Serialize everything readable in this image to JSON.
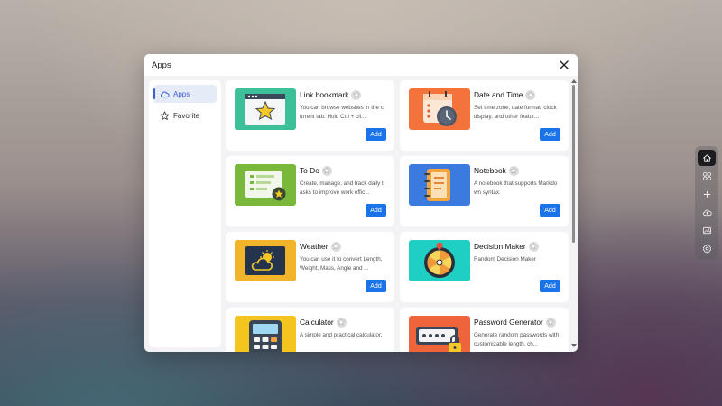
{
  "modal": {
    "title": "Apps"
  },
  "sidebar": {
    "items": [
      {
        "label": "Apps",
        "icon": "cloud-icon",
        "active": true
      },
      {
        "label": "Favorite",
        "icon": "star-outline-icon",
        "active": false
      }
    ]
  },
  "apps": [
    {
      "name": "Link bookmark",
      "desc": "You can browse websites in the current tab. Hold Ctrl + cli...",
      "add_label": "Add",
      "thumb_color": "#3dbf9a",
      "icon": "bookmark-star-icon"
    },
    {
      "name": "Date and Time",
      "desc": "Set time zone, date format, clock display, and other featur...",
      "add_label": "Add",
      "thumb_color": "#f4733a",
      "icon": "calendar-clock-icon"
    },
    {
      "name": "To Do",
      "desc": "Create, manage, and track daily tasks to improve work effic...",
      "add_label": "Add",
      "thumb_color": "#7ab83c",
      "icon": "todo-list-icon"
    },
    {
      "name": "Notebook",
      "desc": "A notebook that supports Markdown syntax.",
      "add_label": "Add",
      "thumb_color": "#3b7be0",
      "icon": "notebook-icon"
    },
    {
      "name": "Weather",
      "desc": "You can use it to convert Length, Weight, Mass, Angle and ...",
      "add_label": "Add",
      "thumb_color": "#f2b42a",
      "icon": "weather-icon"
    },
    {
      "name": "Decision Maker",
      "desc": "Random Decision Maker",
      "add_label": "Add",
      "thumb_color": "#1fcfc4",
      "icon": "decision-wheel-icon"
    },
    {
      "name": "Calculator",
      "desc": "A simple and practical calculator.",
      "add_label": "",
      "thumb_color": "#f5c51f",
      "icon": "calculator-icon"
    },
    {
      "name": "Password Generator",
      "desc": "Generate random passwords with customizable length, ch...",
      "add_label": "",
      "thumb_color": "#f0643c",
      "icon": "password-lock-icon"
    }
  ],
  "dock": {
    "items": [
      "home-icon",
      "apps-grid-icon",
      "plus-icon",
      "cloud-upload-icon",
      "image-icon",
      "settings-icon"
    ]
  },
  "colors": {
    "accent": "#1a73e8",
    "sidebar_active": "#3b5fd9"
  }
}
